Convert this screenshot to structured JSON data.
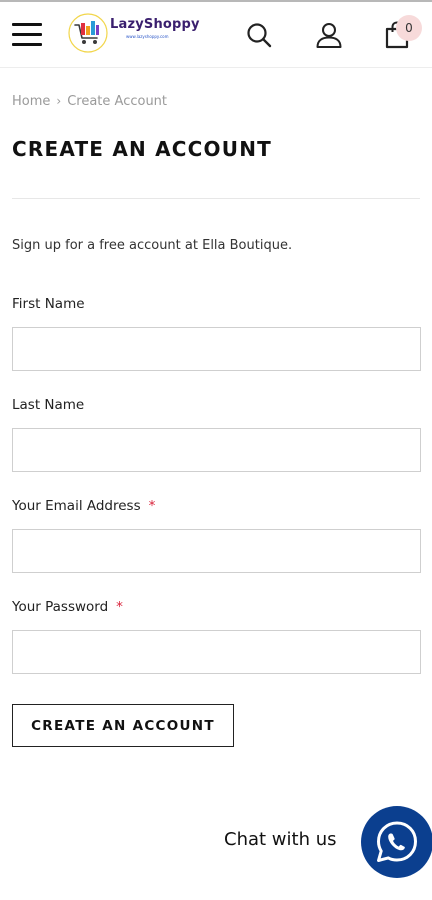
{
  "header": {
    "logo_text": "LazyShoppy",
    "logo_subtext": "www.lazyshoppy.com",
    "cart_count": "0",
    "icons": [
      "menu-icon",
      "search-icon",
      "account-icon",
      "cart-icon"
    ]
  },
  "breadcrumb": {
    "home": "Home",
    "separator": "›",
    "current": "Create Account"
  },
  "page": {
    "title": "CREATE AN ACCOUNT",
    "intro": "Sign up for a free account at Ella Boutique."
  },
  "form": {
    "first_name": {
      "label": "First Name",
      "value": "",
      "placeholder": ""
    },
    "last_name": {
      "label": "Last Name",
      "value": "",
      "placeholder": ""
    },
    "email": {
      "label": "Your Email Address",
      "required_mark": "*",
      "value": "",
      "placeholder": ""
    },
    "password": {
      "label": "Your Password",
      "required_mark": "*",
      "value": "",
      "placeholder": ""
    },
    "submit_label": "CREATE AN ACCOUNT"
  },
  "chat": {
    "label": "Chat with us",
    "icon": "whatsapp-icon",
    "color": "#0b3f8f"
  },
  "colors": {
    "required": "#d9223a",
    "cart_badge": "#f7dada",
    "border": "#cfcfcf"
  }
}
